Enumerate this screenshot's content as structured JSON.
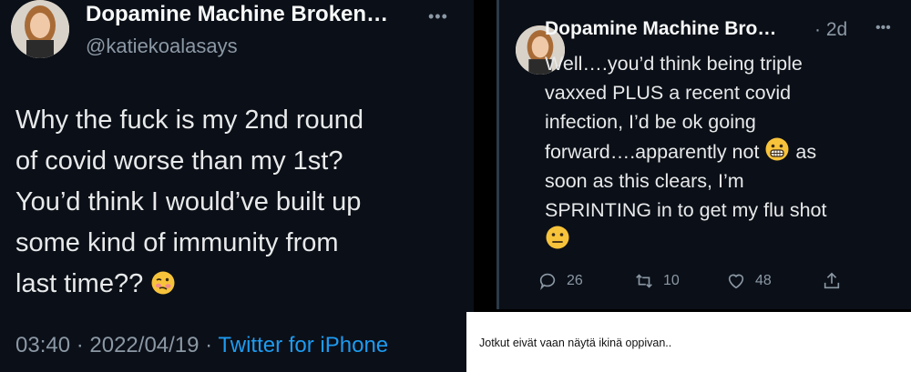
{
  "left_tweet": {
    "display_name": "Dopamine Machine Broken…",
    "handle": "@katiekoalasays",
    "text_lines": [
      "Why the fuck is my 2nd round",
      "of covid worse than my 1st?",
      "You’d think I would’ve built up",
      "some kind of immunity from",
      "last time??"
    ],
    "timestamp": "03:40 · 2022/04/19 ·",
    "source": "Twitter for iPhone",
    "icons": [
      "more-horizontal-icon",
      "woozy-face-emoji"
    ]
  },
  "right_reply": {
    "display_name": "Dopamine Machine Bro…",
    "time": "· 2d",
    "text_lines": [
      "Well….you’d think being triple",
      "vaxxed PLUS a recent covid",
      "infection, I’d be ok going",
      "forward….apparently not",
      "as",
      "soon as this clears, I’m",
      "SPRINTING in to get my flu shot"
    ],
    "actions": {
      "reply_count": "26",
      "retweet_count": "10",
      "like_count": "48"
    },
    "icons": [
      "grimacing-face-emoji",
      "neutral-face-emoji",
      "reply-icon",
      "retweet-icon",
      "like-icon",
      "share-icon"
    ]
  },
  "caption": "Jotkut eivät vaan näytä ikinä oppivan..",
  "colors": {
    "background": "#0b0f17",
    "text": "#e7e9ea",
    "muted": "#8b98a5",
    "link": "#1d9bf0",
    "divider": "#2b3a48",
    "caption_bg": "#ffffff"
  }
}
